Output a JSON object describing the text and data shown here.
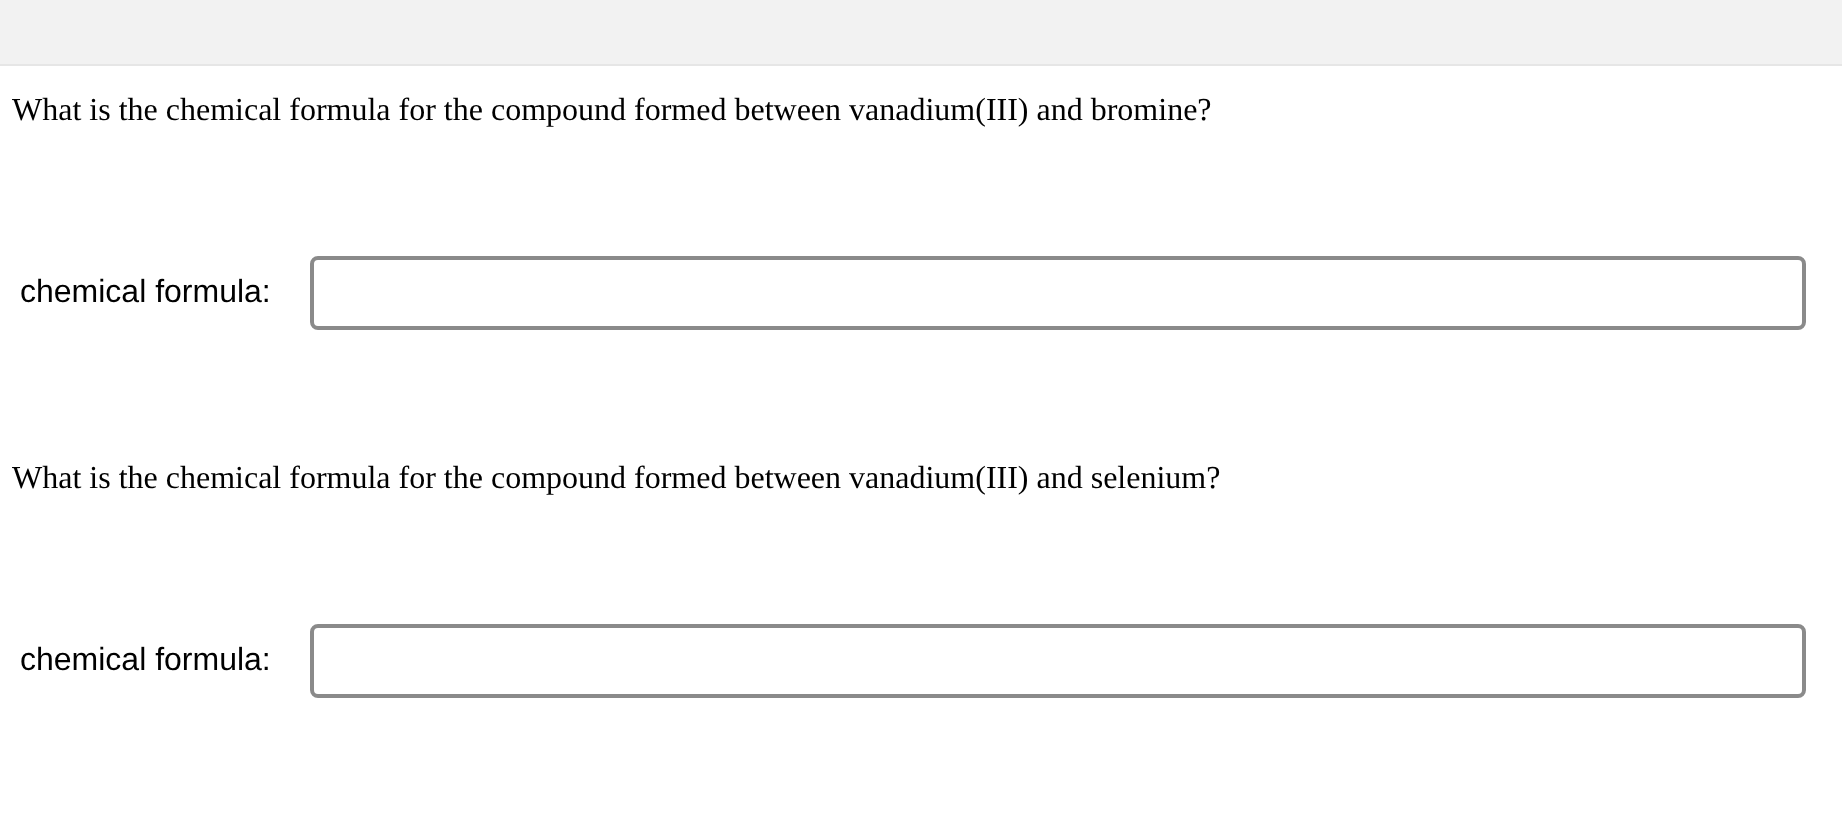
{
  "questions": [
    {
      "question": "What is the chemical formula for the compound formed between vanadium(III) and bromine?",
      "field_label": "chemical formula:"
    },
    {
      "question": "What is the chemical formula for the compound formed between vanadium(III) and selenium?",
      "field_label": "chemical formula:"
    }
  ]
}
